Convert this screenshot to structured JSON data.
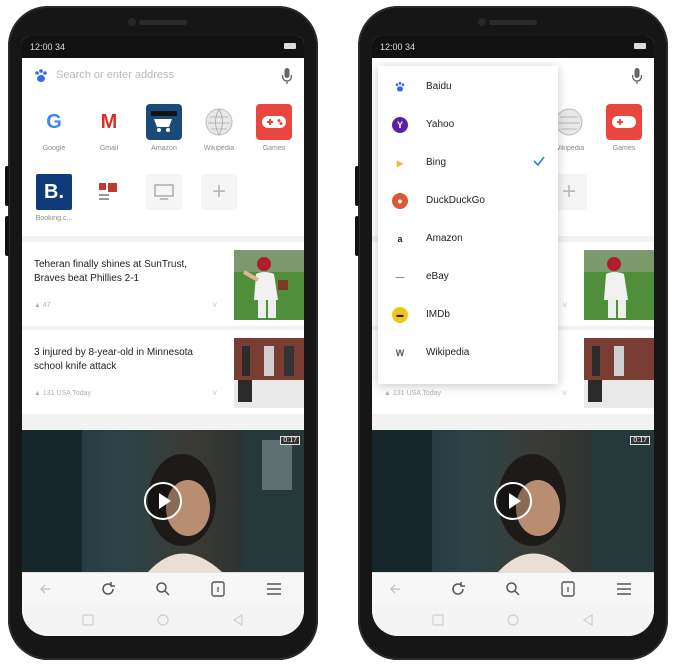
{
  "colors": {
    "accent": "#2f7cf6",
    "background": "#f2f2f2"
  },
  "left_phone": {
    "status": {
      "time": "12:00 34"
    },
    "address_bar": {
      "placeholder": "Search or enter address",
      "left_icon": "baidu-paw-icon",
      "right_icon": "microphone-icon"
    },
    "speed_dial": [
      {
        "label": "Google",
        "icon": "google-icon"
      },
      {
        "label": "Gmail",
        "icon": "gmail-icon"
      },
      {
        "label": "Amazon",
        "icon": "amazon-cart-icon"
      },
      {
        "label": "Wikipedia",
        "icon": "wikipedia-globe-icon"
      },
      {
        "label": "Games",
        "icon": "gamepad-icon"
      },
      {
        "label": "Booking.c...",
        "icon": "booking-icon"
      },
      {
        "label": "",
        "icon": "news-icon"
      },
      {
        "label": "",
        "icon": "screen-icon"
      },
      {
        "label": "",
        "icon": "add-icon"
      }
    ],
    "news": [
      {
        "title": "Teheran finally shines at SunTrust, Braves beat Phillies 2-1",
        "meta": "47",
        "image": "baseball-pitcher-image"
      },
      {
        "title": "3 injured by 8-year-old in Minnesota school knife attack",
        "meta": "131  USA Today",
        "image": "building-image"
      }
    ],
    "video": {
      "badge": "0:17"
    }
  },
  "right_phone": {
    "status": {
      "time": "12:00 34"
    },
    "search_engines": [
      {
        "label": "Baidu",
        "icon": "baidu-icon",
        "color": "#2f6bf2",
        "selected": false
      },
      {
        "label": "Yahoo",
        "icon": "yahoo-icon",
        "color": "#5a1fa8",
        "selected": false
      },
      {
        "label": "Bing",
        "icon": "bing-icon",
        "color": "#f2b631",
        "selected": true
      },
      {
        "label": "DuckDuckGo",
        "icon": "duckduckgo-icon",
        "color": "#de5833",
        "selected": false
      },
      {
        "label": "Amazon",
        "icon": "amazon-icon",
        "color": "#222222",
        "selected": false
      },
      {
        "label": "eBay",
        "icon": "ebay-icon",
        "color": "#888888",
        "selected": false
      },
      {
        "label": "IMDb",
        "icon": "imdb-icon",
        "color": "#f0c419",
        "selected": false
      },
      {
        "label": "Wikipedia",
        "icon": "wikipedia-icon",
        "color": "#555555",
        "selected": false
      }
    ],
    "visible_tiles": [
      {
        "label": "Wikipedia"
      },
      {
        "label": "Games"
      }
    ],
    "news_meta": "131  USA Today",
    "video": {
      "badge": "0:17"
    }
  },
  "toolbar": {
    "icons": [
      "back-icon",
      "reload-icon",
      "search-icon",
      "tabs-icon",
      "menu-icon"
    ]
  },
  "navbar": {
    "icons": [
      "recent-apps-icon",
      "home-icon",
      "back-nav-icon"
    ]
  }
}
